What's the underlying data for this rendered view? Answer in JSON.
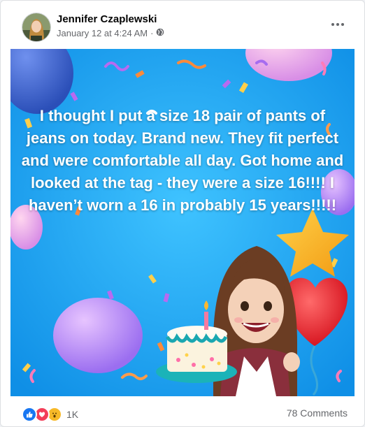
{
  "post": {
    "author": "Jennifer Czaplewski",
    "timestamp": "January 12 at 4:24 AM",
    "separator": "·",
    "privacy_icon": "globe-icon",
    "more_icon": "more-options-icon",
    "text": "I thought I put a size 18 pair of pants of jeans on today. Brand new. They fit perfect and were comfortable all day. Got home and looked at the tag - they were a size 16!!!! I haven’t worn a 16 in probably 15 years!!!!!",
    "background_color": "#19a4f2"
  },
  "footer": {
    "reaction_icons": [
      "like-icon",
      "love-icon",
      "wow-icon"
    ],
    "reaction_count": "1K",
    "comments_label": "78 Comments"
  },
  "colors": {
    "like": "#1877f2",
    "love": "#f33e58",
    "wow": "#f7b928",
    "text_primary": "#050505",
    "text_secondary": "#65676b"
  }
}
